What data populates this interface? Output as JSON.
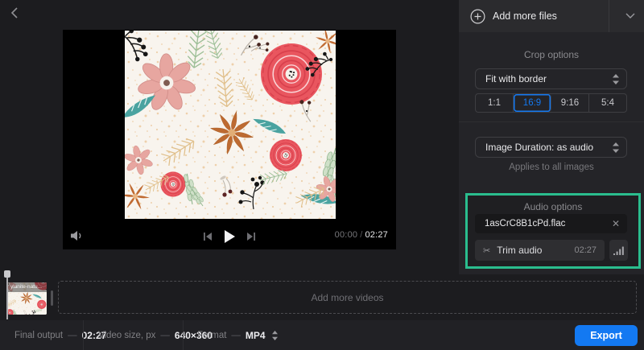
{
  "theme": {
    "accent": "#1379f2",
    "highlight": "#2abd8e"
  },
  "icons": {
    "close": "✕",
    "scissors": "✂"
  },
  "player": {
    "current": "00:00",
    "sep": "/",
    "total": "02:27"
  },
  "sidebar": {
    "add_files_label": "Add more files",
    "crop_title": "Crop options",
    "crop_mode": "Fit with border",
    "ratios": [
      "1:1",
      "16:9",
      "9:16",
      "5:4"
    ],
    "selected_ratio": "16:9",
    "duration_value": "Image Duration: as audio",
    "duration_note": "Applies to all images",
    "audio_title": "Audio options",
    "audio_file": "1asCrC8B1cPd.flac",
    "trim_label": "Trim audio",
    "trim_duration": "02:27"
  },
  "timeline": {
    "clip_name": "ylanite-natu...",
    "add_videos_label": "Add more videos"
  },
  "footer": {
    "sep": "—",
    "final_label": "Final output",
    "final_value": "02:27",
    "size_label": "Video size, px",
    "size_value": "640×360",
    "format_label": "Format",
    "format_value": "MP4",
    "export_label": "Export"
  }
}
